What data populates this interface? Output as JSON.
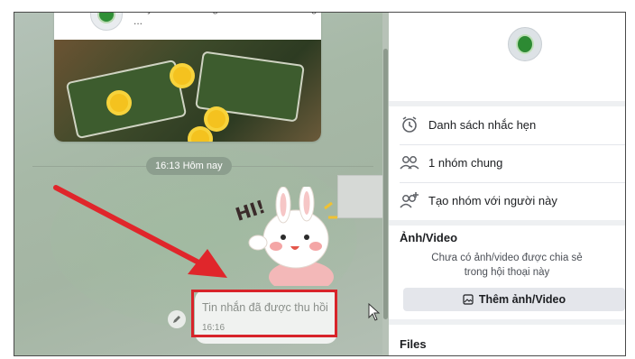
{
  "chat": {
    "preview_text": "Hãy bắt đầu cùng nhau chia sẻ những ...",
    "time_divider": "16:13 Hôm nay",
    "recalled_message": "Tin nhắn đã được thu hồi",
    "recalled_time": "16:16",
    "sticker_text": "HI!"
  },
  "info": {
    "rows": [
      {
        "label": "Danh sách nhắc hẹn",
        "icon": "alarm-clock-icon"
      },
      {
        "label": "1 nhóm chung",
        "icon": "group-icon"
      },
      {
        "label": "Tạo nhóm với người này",
        "icon": "add-group-icon"
      }
    ],
    "media_title": "Ảnh/Video",
    "media_empty_line1": "Chưa có ảnh/video được chia sẻ",
    "media_empty_line2": "trong hội thoại này",
    "add_media_label": "Thêm ảnh/Video",
    "files_title": "Files"
  },
  "colors": {
    "highlight": "#d8242a",
    "arrow": "#e0262b",
    "chat_bg": "#a9baa9"
  }
}
